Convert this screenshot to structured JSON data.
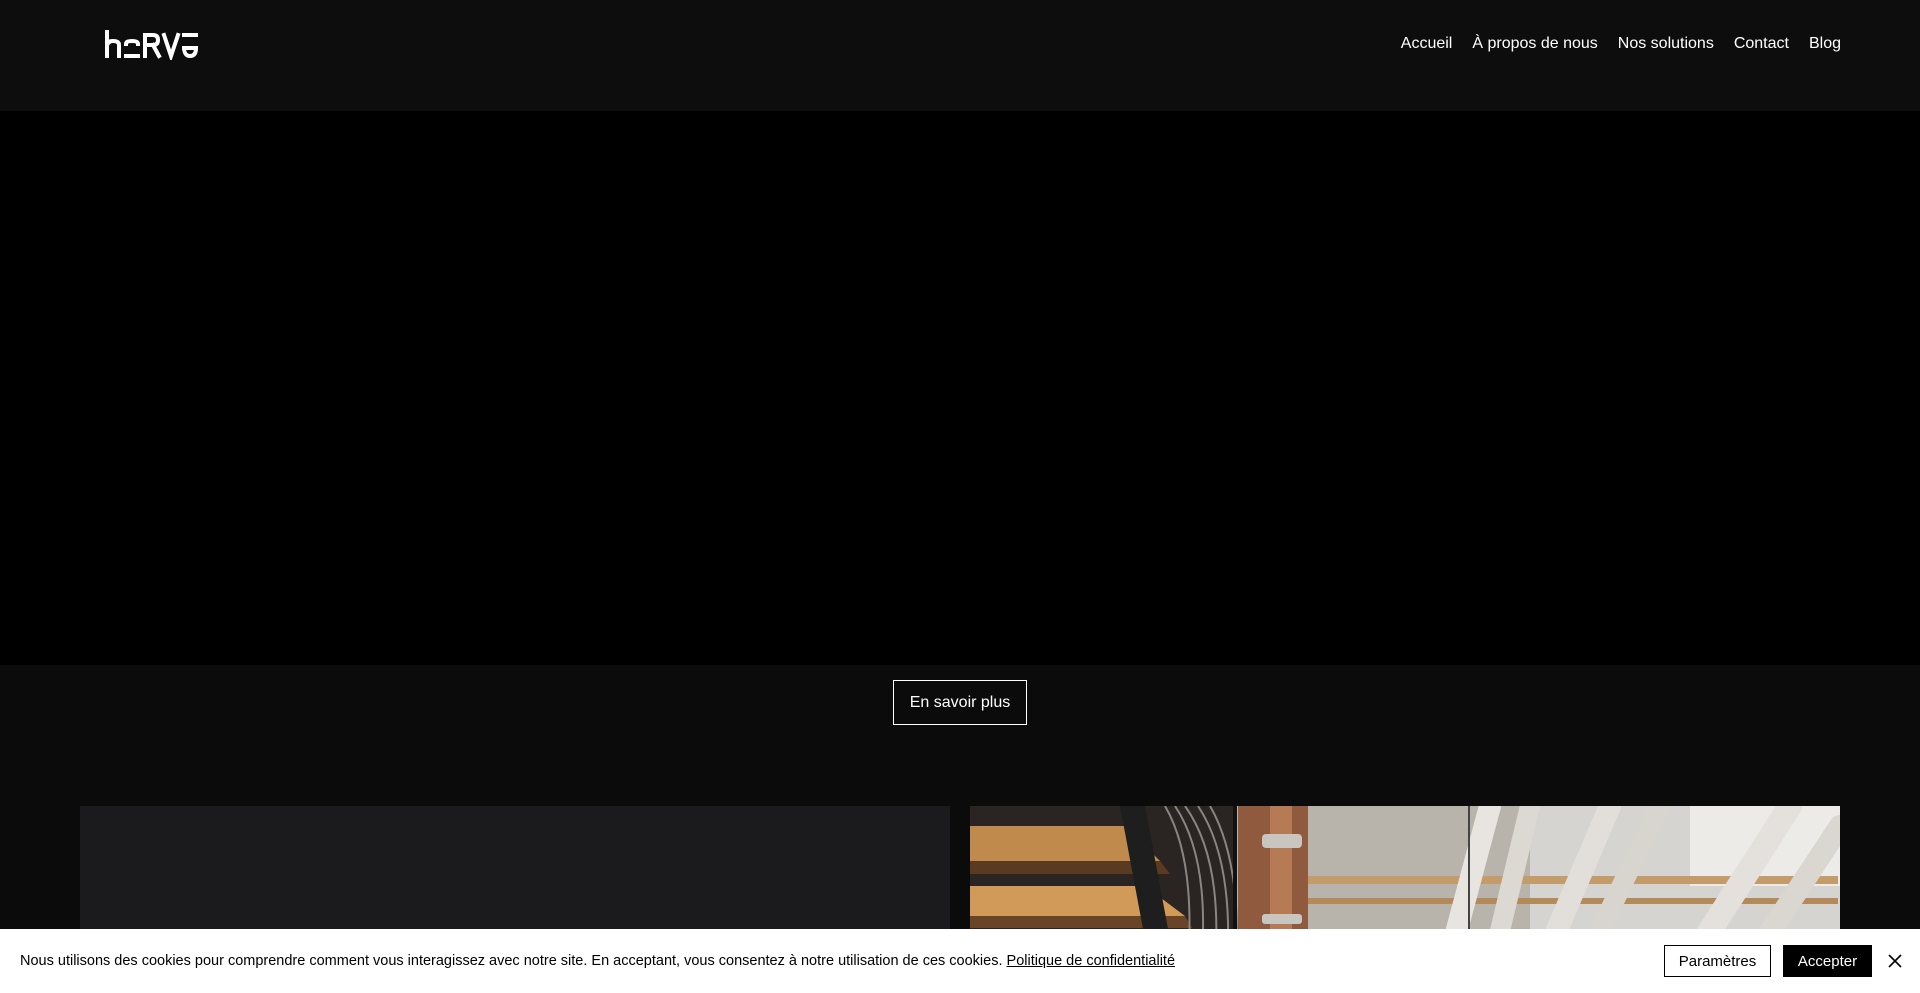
{
  "brand": {
    "logo_text": "herve",
    "logo_icon": "herve-wordmark-logo"
  },
  "nav": {
    "items": [
      {
        "label": "Accueil"
      },
      {
        "label": "À propos de nous"
      },
      {
        "label": "Nos solutions"
      },
      {
        "label": "Contact"
      },
      {
        "label": "Blog"
      }
    ]
  },
  "hero": {
    "cta_label": "En savoir plus"
  },
  "cookie": {
    "message": "Nous utilisons des cookies pour comprendre comment vous interagissez avec notre site. En acceptant, vous consentez à notre utilisation de ces cookies. ",
    "policy_link": "Politique de confidentialité",
    "settings_label": "Paramètres",
    "accept_label": "Accepter",
    "close_icon": "close-icon"
  },
  "colors": {
    "page_bg": "#0b0b0b",
    "header_bg": "#0d0d0d",
    "hero_bg": "#000000",
    "panel_bg": "#1b1b1d",
    "cookie_bg": "#ffffff"
  }
}
